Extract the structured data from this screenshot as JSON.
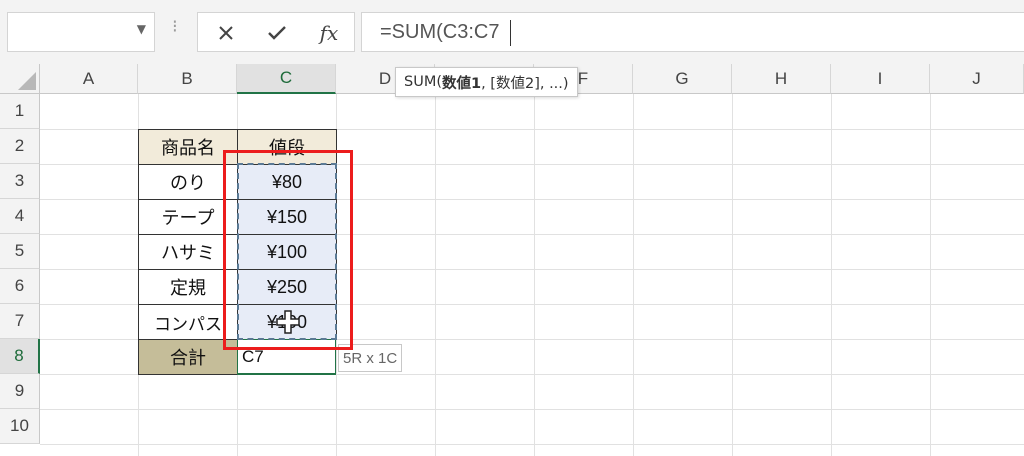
{
  "formula_bar": {
    "name_box": "",
    "cancel_icon": "close-icon",
    "enter_icon": "check-icon",
    "fx_label": "fx",
    "formula": "=SUM(C3:C7"
  },
  "columns": [
    "A",
    "B",
    "C",
    "D",
    "E",
    "F",
    "G",
    "H",
    "I",
    "J"
  ],
  "rows": [
    "1",
    "2",
    "3",
    "4",
    "5",
    "6",
    "7",
    "8",
    "9",
    "10"
  ],
  "active_column": "C",
  "active_row": "8",
  "table": {
    "header": {
      "name": "商品名",
      "price": "値段"
    },
    "items": [
      {
        "name": "のり",
        "price": "¥80"
      },
      {
        "name": "テープ",
        "price": "¥150"
      },
      {
        "name": "ハサミ",
        "price": "¥100"
      },
      {
        "name": "定規",
        "price": "¥250"
      },
      {
        "name": "コンパス",
        "price": "¥100"
      }
    ],
    "total_label": "合計"
  },
  "edit_cell_text": "C7",
  "range_size_tooltip": "5R x 1C",
  "arg_tooltip": {
    "fn": "SUM(",
    "arg1": "数値1",
    "rest": ", [数値2], ...)"
  },
  "colors": {
    "accent": "#217346",
    "highlight_box": "#ec1c1c",
    "header_fill": "#f2ebda",
    "total_fill": "#c5bd99",
    "selection_fill": "#e7ecf7"
  }
}
